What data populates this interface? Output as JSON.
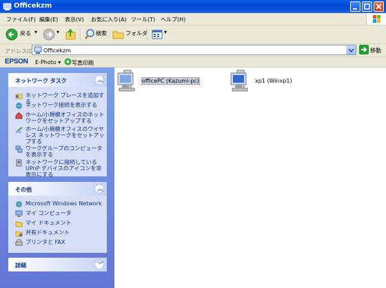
{
  "window": {
    "title": "Officekzm"
  },
  "menu": [
    "ファイル(F)",
    "編集(E)",
    "表示(V)",
    "お気に入り(A)",
    "ツール(T)",
    "ヘルプ(H)"
  ],
  "toolbar": {
    "back_label": "戻る",
    "search_label": "検索",
    "folders_label": "フォルダ"
  },
  "address": {
    "label": "アドレス(D)",
    "value": "Officekzm",
    "go_label": "移動"
  },
  "epson": {
    "logo": "EPSON",
    "ephoto_label": "E-Photo ▾",
    "print_label": "写真印刷"
  },
  "network_tasks": {
    "title": "ネットワーク タスク",
    "items": [
      "ネットワーク プレースを追加する",
      "ネットワーク接続を表示する",
      "ホーム/小規模オフィスのネットワークをセットアップする",
      "ホーム/小規模オフィスのワイヤレス ネットワークをセットアップする",
      "ワークグループのコンピュータを表示する",
      "ネットワークに接続しているUPnP デバイスのアイコンを非表示にする"
    ]
  },
  "other_places": {
    "title": "その他",
    "items": [
      "Microsoft Windows Network",
      "マイ コンピュータ",
      "マイ ドキュメント",
      "共有ドキュメント",
      "プリンタと FAX"
    ]
  },
  "details": {
    "title": "詳細"
  },
  "computers": [
    {
      "label": "officePC (Kazumi-pc)",
      "selected": true
    },
    {
      "label": "xp1 (Winxp1)",
      "selected": false
    }
  ],
  "colors": {
    "title_bar": "#0148d6",
    "task_link": "#0c2f8d",
    "left_pane": "#6f8fde"
  }
}
